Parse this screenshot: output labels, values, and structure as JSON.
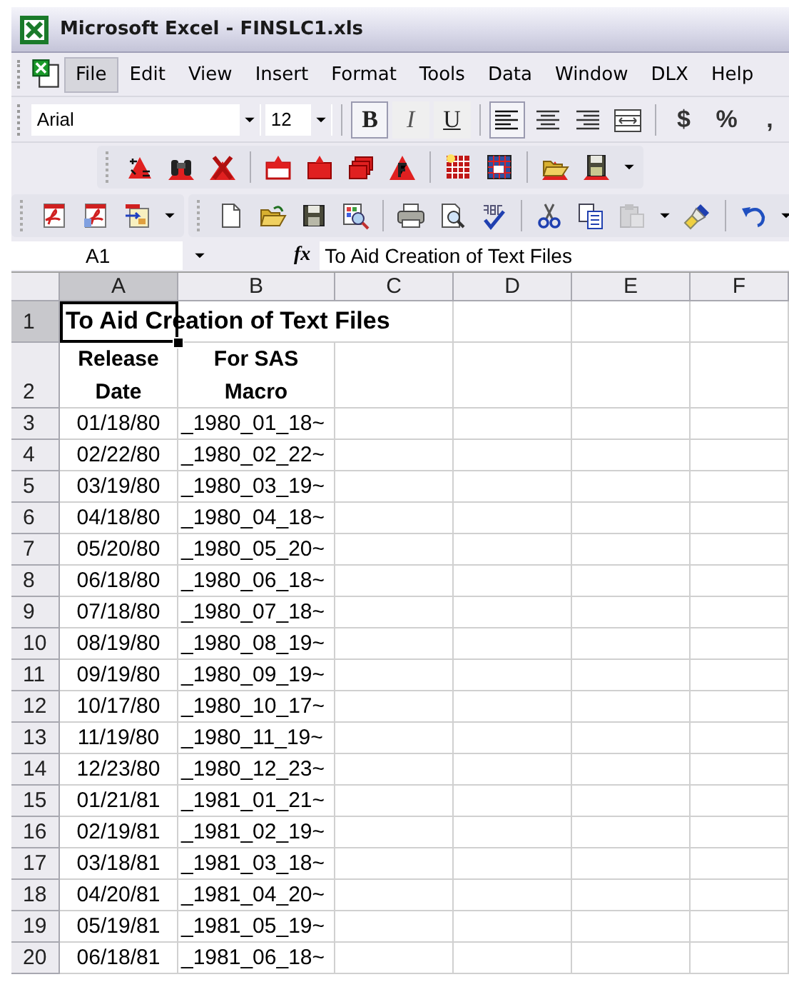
{
  "window": {
    "title": "Microsoft Excel - FINSLC1.xls"
  },
  "menu": [
    {
      "label": "File",
      "selected": true
    },
    {
      "label": "Edit",
      "selected": false
    },
    {
      "label": "View",
      "selected": false
    },
    {
      "label": "Insert",
      "selected": false
    },
    {
      "label": "Format",
      "selected": false
    },
    {
      "label": "Tools",
      "selected": false
    },
    {
      "label": "Data",
      "selected": false
    },
    {
      "label": "Window",
      "selected": false
    },
    {
      "label": "DLX",
      "selected": false
    },
    {
      "label": "Help",
      "selected": false
    }
  ],
  "formatting_toolbar": {
    "font": "Arial",
    "size": "12",
    "styles": [
      {
        "kind": "bold",
        "label": "B",
        "selected": true
      },
      {
        "kind": "italic",
        "label": "I",
        "selected": false
      },
      {
        "kind": "underline",
        "label": "U",
        "selected": false
      }
    ],
    "alignment": [
      {
        "kind": "left",
        "selected": true
      },
      {
        "kind": "center",
        "selected": false
      },
      {
        "kind": "right",
        "selected": false
      },
      {
        "kind": "merge",
        "selected": false
      }
    ],
    "number_formats": [
      "$",
      "%",
      ","
    ]
  },
  "formula_bar": {
    "name_box": "A1",
    "function_label": "fx",
    "content": "To Aid Creation of Text Files"
  },
  "sheet": {
    "columns": [
      {
        "label": "A",
        "selected": true
      },
      {
        "label": "B",
        "selected": false
      },
      {
        "label": "C",
        "selected": false
      },
      {
        "label": "D",
        "selected": false
      },
      {
        "label": "E",
        "selected": false
      },
      {
        "label": "F",
        "selected": false
      }
    ],
    "title_row": {
      "number": "1",
      "selected": true,
      "text": "To Aid Creation of Text Files"
    },
    "header_row": {
      "number": "2",
      "selected": false,
      "cells": [
        "Release Date",
        "For SAS Macro"
      ]
    },
    "rows": [
      {
        "number": "3",
        "date": "01/18/80",
        "macro": "_1980_01_18~"
      },
      {
        "number": "4",
        "date": "02/22/80",
        "macro": "_1980_02_22~"
      },
      {
        "number": "5",
        "date": "03/19/80",
        "macro": "_1980_03_19~"
      },
      {
        "number": "6",
        "date": "04/18/80",
        "macro": "_1980_04_18~"
      },
      {
        "number": "7",
        "date": "05/20/80",
        "macro": "_1980_05_20~"
      },
      {
        "number": "8",
        "date": "06/18/80",
        "macro": "_1980_06_18~"
      },
      {
        "number": "9",
        "date": "07/18/80",
        "macro": "_1980_07_18~"
      },
      {
        "number": "10",
        "date": "08/19/80",
        "macro": "_1980_08_19~"
      },
      {
        "number": "11",
        "date": "09/19/80",
        "macro": "_1980_09_19~"
      },
      {
        "number": "12",
        "date": "10/17/80",
        "macro": "_1980_10_17~"
      },
      {
        "number": "13",
        "date": "11/19/80",
        "macro": "_1980_11_19~"
      },
      {
        "number": "14",
        "date": "12/23/80",
        "macro": "_1980_12_23~"
      },
      {
        "number": "15",
        "date": "01/21/81",
        "macro": "_1981_01_21~"
      },
      {
        "number": "16",
        "date": "02/19/81",
        "macro": "_1981_02_19~"
      },
      {
        "number": "17",
        "date": "03/18/81",
        "macro": "_1981_03_18~"
      },
      {
        "number": "18",
        "date": "04/20/81",
        "macro": "_1981_04_20~"
      },
      {
        "number": "19",
        "date": "05/19/81",
        "macro": "_1981_05_19~"
      },
      {
        "number": "20",
        "date": "06/18/81",
        "macro": "_1981_06_18~"
      }
    ]
  }
}
